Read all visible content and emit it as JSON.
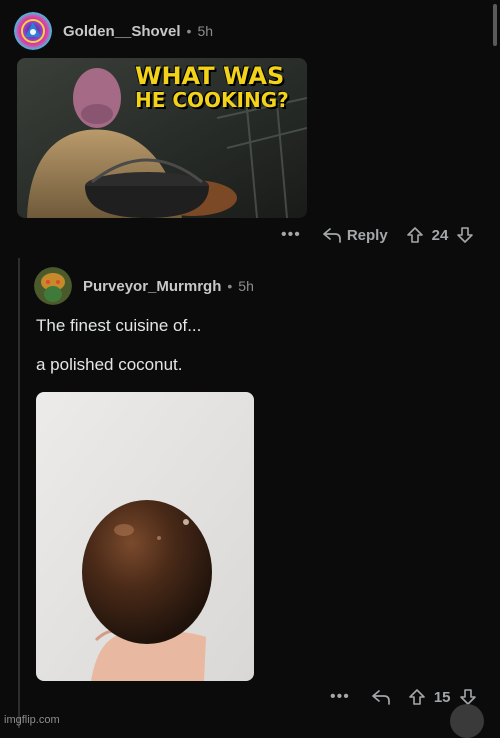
{
  "comments": [
    {
      "username": "Golden__Shovel",
      "separator": "•",
      "time": "5h",
      "meme_text": [
        "WHAT WAS",
        "HE COOKING?"
      ],
      "more": "•••",
      "reply_label": "Reply",
      "vote_count": "24"
    },
    {
      "username": "Purveyor_Murmrgh",
      "separator": "•",
      "time": "5h",
      "lines": [
        "The finest cuisine of...",
        "a polished coconut."
      ],
      "more": "•••",
      "vote_count": "15"
    }
  ],
  "watermark": "imgflip.com",
  "colors": {
    "background": "#0b0b0b",
    "meme_yellow": "#f3d21a",
    "muted": "#8a8d8f"
  }
}
